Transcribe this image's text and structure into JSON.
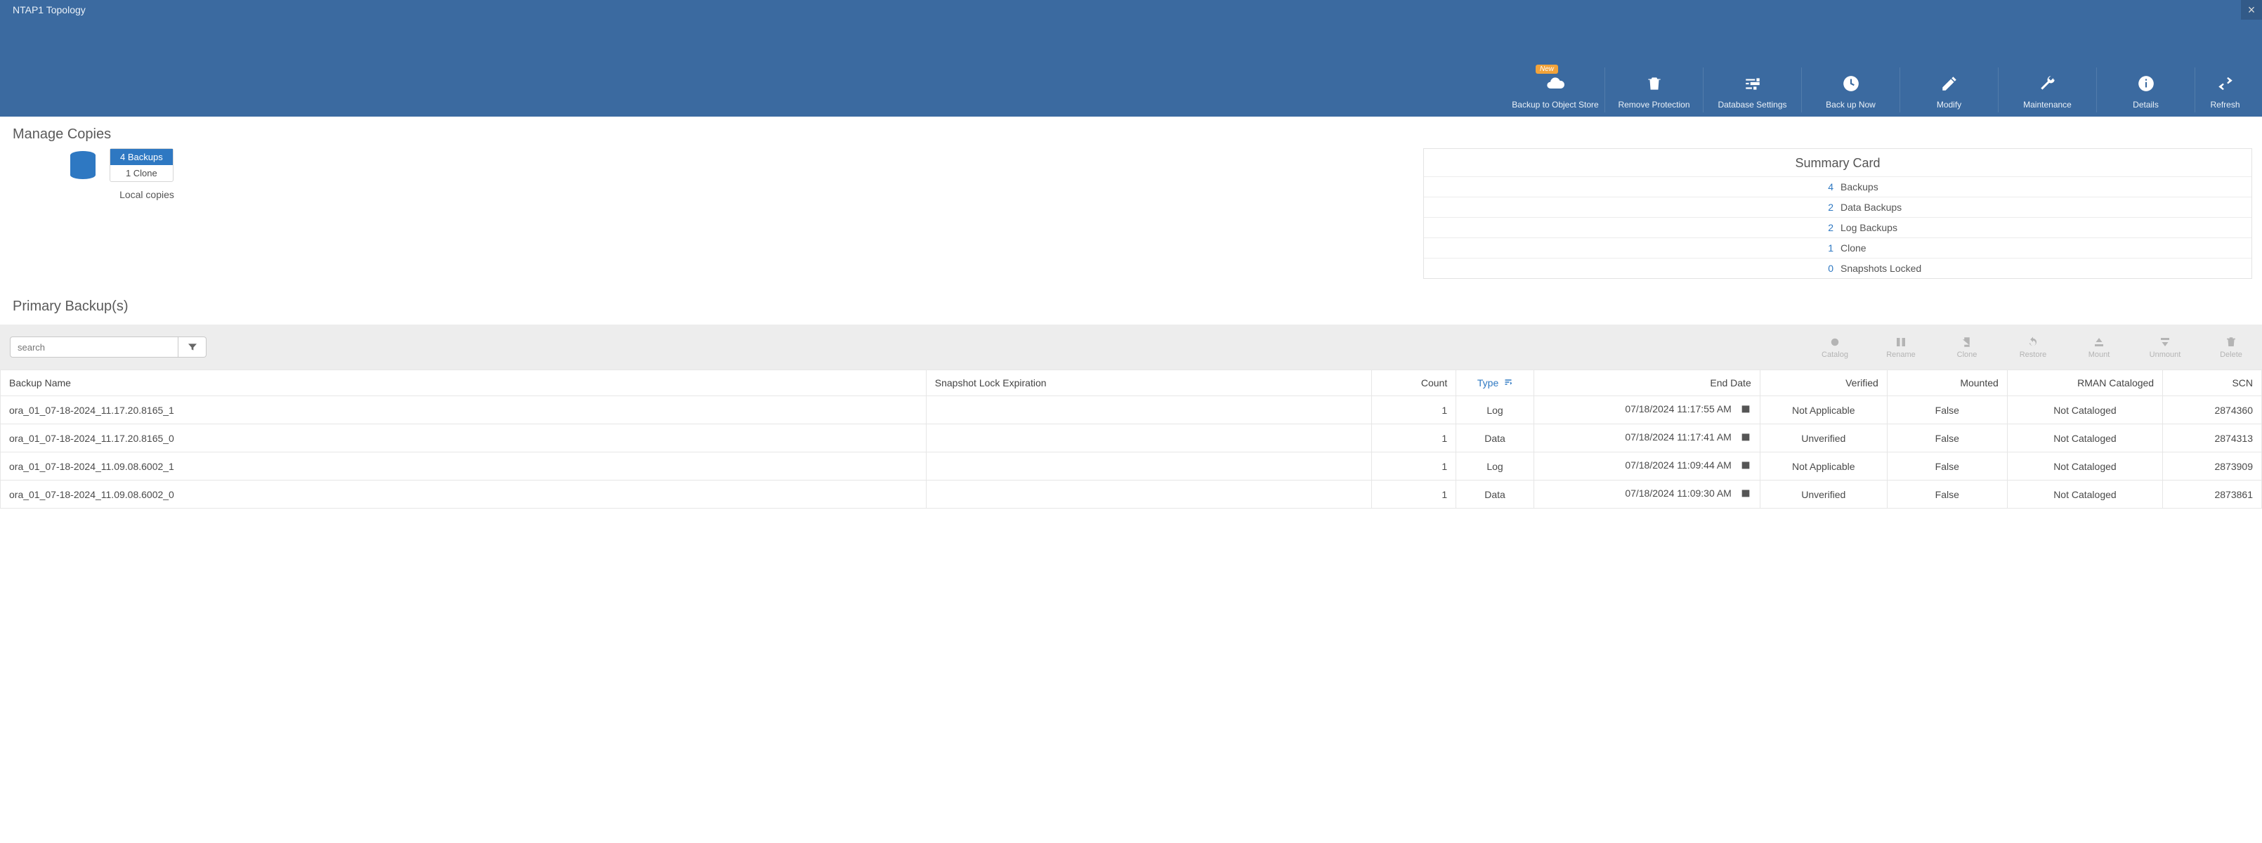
{
  "header": {
    "title": "NTAP1 Topology",
    "close_icon": "×",
    "new_badge": "New",
    "tools": {
      "backup_object_store": "Backup to Object Store",
      "remove_protection": "Remove Protection",
      "database_settings": "Database Settings",
      "back_up_now": "Back up Now",
      "modify": "Modify",
      "maintenance": "Maintenance",
      "details": "Details",
      "refresh": "Refresh"
    }
  },
  "manage_copies": {
    "title": "Manage Copies",
    "backups_badge": "4 Backups",
    "clone_badge": "1 Clone",
    "caption": "Local copies"
  },
  "summary": {
    "title": "Summary Card",
    "rows": [
      {
        "num": "4",
        "txt": "Backups"
      },
      {
        "num": "2",
        "txt": "Data Backups"
      },
      {
        "num": "2",
        "txt": "Log Backups"
      },
      {
        "num": "1",
        "txt": "Clone"
      },
      {
        "num": "0",
        "txt": "Snapshots Locked"
      }
    ]
  },
  "primary": {
    "title": "Primary Backup(s)",
    "search_placeholder": "search",
    "actions": {
      "catalog": "Catalog",
      "rename": "Rename",
      "clone": "Clone",
      "restore": "Restore",
      "mount": "Mount",
      "unmount": "Unmount",
      "delete": "Delete"
    },
    "columns": {
      "name": "Backup Name",
      "snap": "Snapshot Lock Expiration",
      "count": "Count",
      "type": "Type",
      "end": "End Date",
      "ver": "Verified",
      "mnt": "Mounted",
      "cat": "RMAN Cataloged",
      "scn": "SCN"
    },
    "rows": [
      {
        "name": "ora_01_07-18-2024_11.17.20.8165_1",
        "snap": "",
        "count": "1",
        "type": "Log",
        "end": "07/18/2024 11:17:55 AM",
        "ver": "Not Applicable",
        "mnt": "False",
        "cat": "Not Cataloged",
        "scn": "2874360"
      },
      {
        "name": "ora_01_07-18-2024_11.17.20.8165_0",
        "snap": "",
        "count": "1",
        "type": "Data",
        "end": "07/18/2024 11:17:41 AM",
        "ver": "Unverified",
        "mnt": "False",
        "cat": "Not Cataloged",
        "scn": "2874313"
      },
      {
        "name": "ora_01_07-18-2024_11.09.08.6002_1",
        "snap": "",
        "count": "1",
        "type": "Log",
        "end": "07/18/2024 11:09:44 AM",
        "ver": "Not Applicable",
        "mnt": "False",
        "cat": "Not Cataloged",
        "scn": "2873909"
      },
      {
        "name": "ora_01_07-18-2024_11.09.08.6002_0",
        "snap": "",
        "count": "1",
        "type": "Data",
        "end": "07/18/2024 11:09:30 AM",
        "ver": "Unverified",
        "mnt": "False",
        "cat": "Not Cataloged",
        "scn": "2873861"
      }
    ]
  }
}
